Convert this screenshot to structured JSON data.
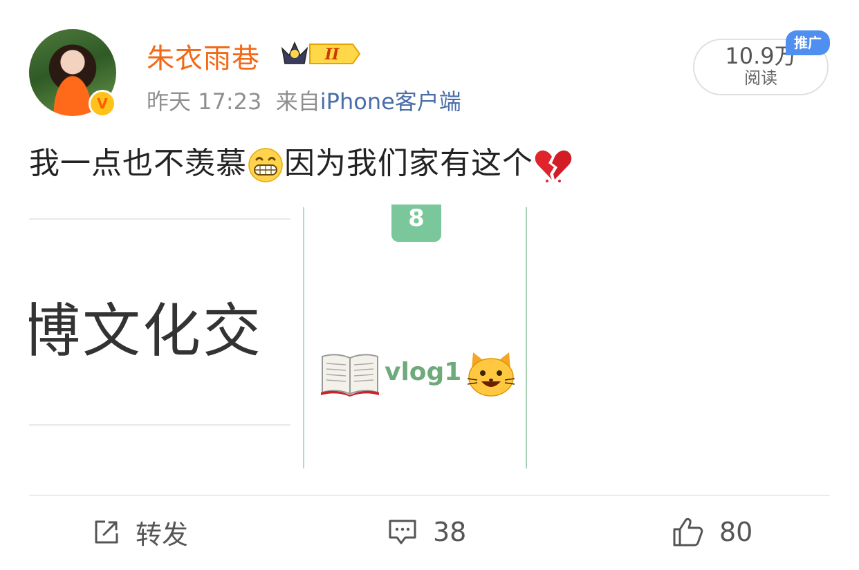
{
  "post": {
    "username": "朱衣雨巷",
    "vip_level": "II",
    "verified_mark": "V",
    "time": "昨天 17:23",
    "source_prefix": "来自",
    "source": "iPhone客户端",
    "read_count": "10.9万",
    "read_label": "阅读",
    "promo_badge": "推广",
    "text_part1": "我一点也不羡慕",
    "text_part2": "因为我们家有这个",
    "emoji_1": "grinning-face-emoji",
    "emoji_2": "broken-heart-emoji"
  },
  "images": {
    "image1_text": "博文化交",
    "image2_number": "8",
    "image2_caption": "vlog1",
    "image2_icons": [
      "open-book-icon",
      "cat-face-icon"
    ]
  },
  "actions": {
    "repost_label": "转发",
    "comment_count": "38",
    "like_count": "80"
  },
  "colors": {
    "username": "#f26a17",
    "source_link": "#4a6ea9",
    "promo": "#4f8ff0",
    "green_accent": "#79c79a"
  }
}
